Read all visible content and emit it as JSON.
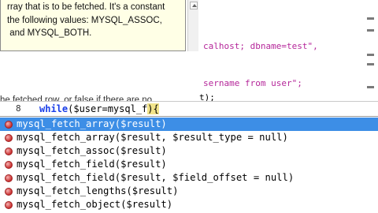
{
  "doc_popup": {
    "lines": [
      "rray that is to be fetched. It's a constant",
      "the following values: MYSQL_ASSOC,",
      " and MYSQL_BOTH."
    ]
  },
  "code": {
    "line_host": "calhost; dbname=test\",",
    "line_query": "sername from user\";",
    "line_t": "t);",
    "line_partial_doc": "he fetched row, or false if there are no"
  },
  "editor": {
    "line_number": "8",
    "keyword": "while",
    "typed": "($user=mysql_f",
    "tail": "){"
  },
  "completion": {
    "items": [
      {
        "label": "mysql_fetch_array($result)",
        "selected": true
      },
      {
        "label": "mysql_fetch_array($result, $result_type = null)",
        "selected": false
      },
      {
        "label": "mysql_fetch_assoc($result)",
        "selected": false
      },
      {
        "label": "mysql_fetch_field($result)",
        "selected": false
      },
      {
        "label": "mysql_fetch_field($result, $field_offset = null)",
        "selected": false
      },
      {
        "label": "mysql_fetch_lengths($result)",
        "selected": false
      },
      {
        "label": "mysql_fetch_object($result)",
        "selected": false
      }
    ]
  },
  "colors": {
    "selected_bg": "#3d8ee6",
    "popup_bg": "#ffffe6",
    "string": "#b5279a",
    "keyword": "#1a3ee8"
  },
  "icons": [
    "method-icon",
    "scroll-up-icon"
  ]
}
